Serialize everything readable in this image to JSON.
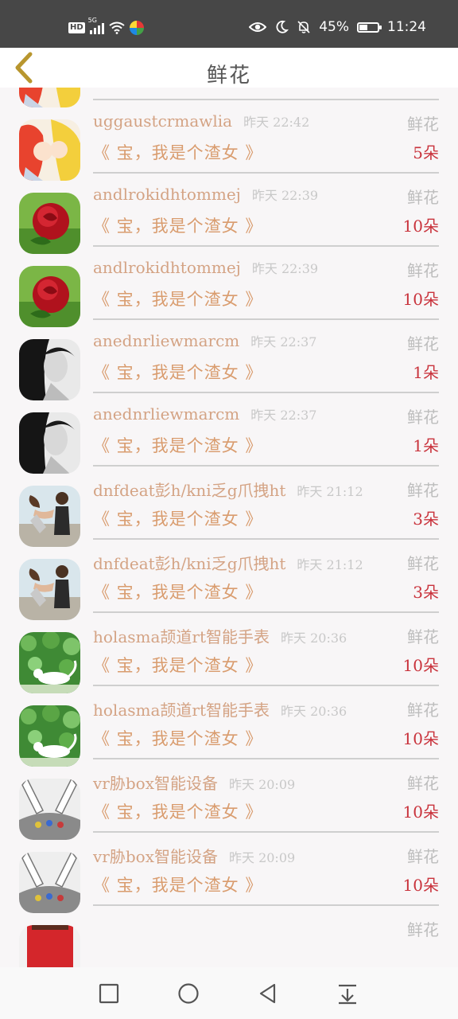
{
  "status_bar": {
    "hd": "HD",
    "network": "5G",
    "battery_text": "45%",
    "battery_level": 0.45,
    "time": "11:24"
  },
  "header": {
    "title": "鲜花",
    "back_icon": "chevron-left-icon"
  },
  "list": {
    "rows": [
      {
        "username": "uggaustcrmawlia",
        "time": "昨天 22:42",
        "type": "鲜花",
        "message": "《 宝，我是个渣女 》",
        "count": "5朵",
        "avatar": "anime-kiss"
      },
      {
        "username": "uggaustcrmawlia",
        "time": "昨天 22:42",
        "type": "鲜花",
        "message": "《 宝，我是个渣女 》",
        "count": "5朵",
        "avatar": "anime-kiss"
      },
      {
        "username": "andlrokidhtommej",
        "time": "昨天 22:39",
        "type": "鲜花",
        "message": "《 宝，我是个渣女 》",
        "count": "10朵",
        "avatar": "red-rose"
      },
      {
        "username": "andlrokidhtommej",
        "time": "昨天 22:39",
        "type": "鲜花",
        "message": "《 宝，我是个渣女 》",
        "count": "10朵",
        "avatar": "red-rose"
      },
      {
        "username": "anednrliewmarcm",
        "time": "昨天 22:37",
        "type": "鲜花",
        "message": "《 宝，我是个渣女 》",
        "count": "1朵",
        "avatar": "bw-portrait"
      },
      {
        "username": "anednrliewmarcm",
        "time": "昨天 22:37",
        "type": "鲜花",
        "message": "《 宝，我是个渣女 》",
        "count": "1朵",
        "avatar": "bw-portrait"
      },
      {
        "username": "dnfdeat彭h/kni乏g爪拽ht",
        "time": "昨天 21:12",
        "type": "鲜花",
        "message": "《 宝，我是个渣女 》",
        "count": "3朵",
        "avatar": "couple-dance"
      },
      {
        "username": "dnfdeat彭h/kni乏g爪拽ht",
        "time": "昨天 21:12",
        "type": "鲜花",
        "message": "《 宝，我是个渣女 》",
        "count": "3朵",
        "avatar": "couple-dance"
      },
      {
        "username": "holasma颉道rt智能手表",
        "time": "昨天 20:36",
        "type": "鲜花",
        "message": "《 宝，我是个渣女 》",
        "count": "10朵",
        "avatar": "white-cat-leaves"
      },
      {
        "username": "holasma颉道rt智能手表",
        "time": "昨天 20:36",
        "type": "鲜花",
        "message": "《 宝，我是个渣女 》",
        "count": "10朵",
        "avatar": "white-cat-leaves"
      },
      {
        "username": "vr胁box智能设备",
        "time": "昨天 20:09",
        "type": "鲜花",
        "message": "《 宝，我是个渣女 》",
        "count": "10朵",
        "avatar": "hands-sketch"
      },
      {
        "username": "vr胁box智能设备",
        "time": "昨天 20:09",
        "type": "鲜花",
        "message": "《 宝，我是个渣女 》",
        "count": "10朵",
        "avatar": "hands-sketch"
      },
      {
        "username": "",
        "time": "",
        "type": "鲜花",
        "message": "",
        "count": "",
        "avatar": "red-cartoon"
      }
    ]
  },
  "navbar": {
    "buttons": [
      "recent-apps-icon",
      "home-icon",
      "back-icon",
      "notification-pulldown-icon"
    ]
  },
  "colors": {
    "username": "#d4a384",
    "message": "#d99c6e",
    "count": "#c9333c",
    "back_icon": "#b8962e"
  }
}
